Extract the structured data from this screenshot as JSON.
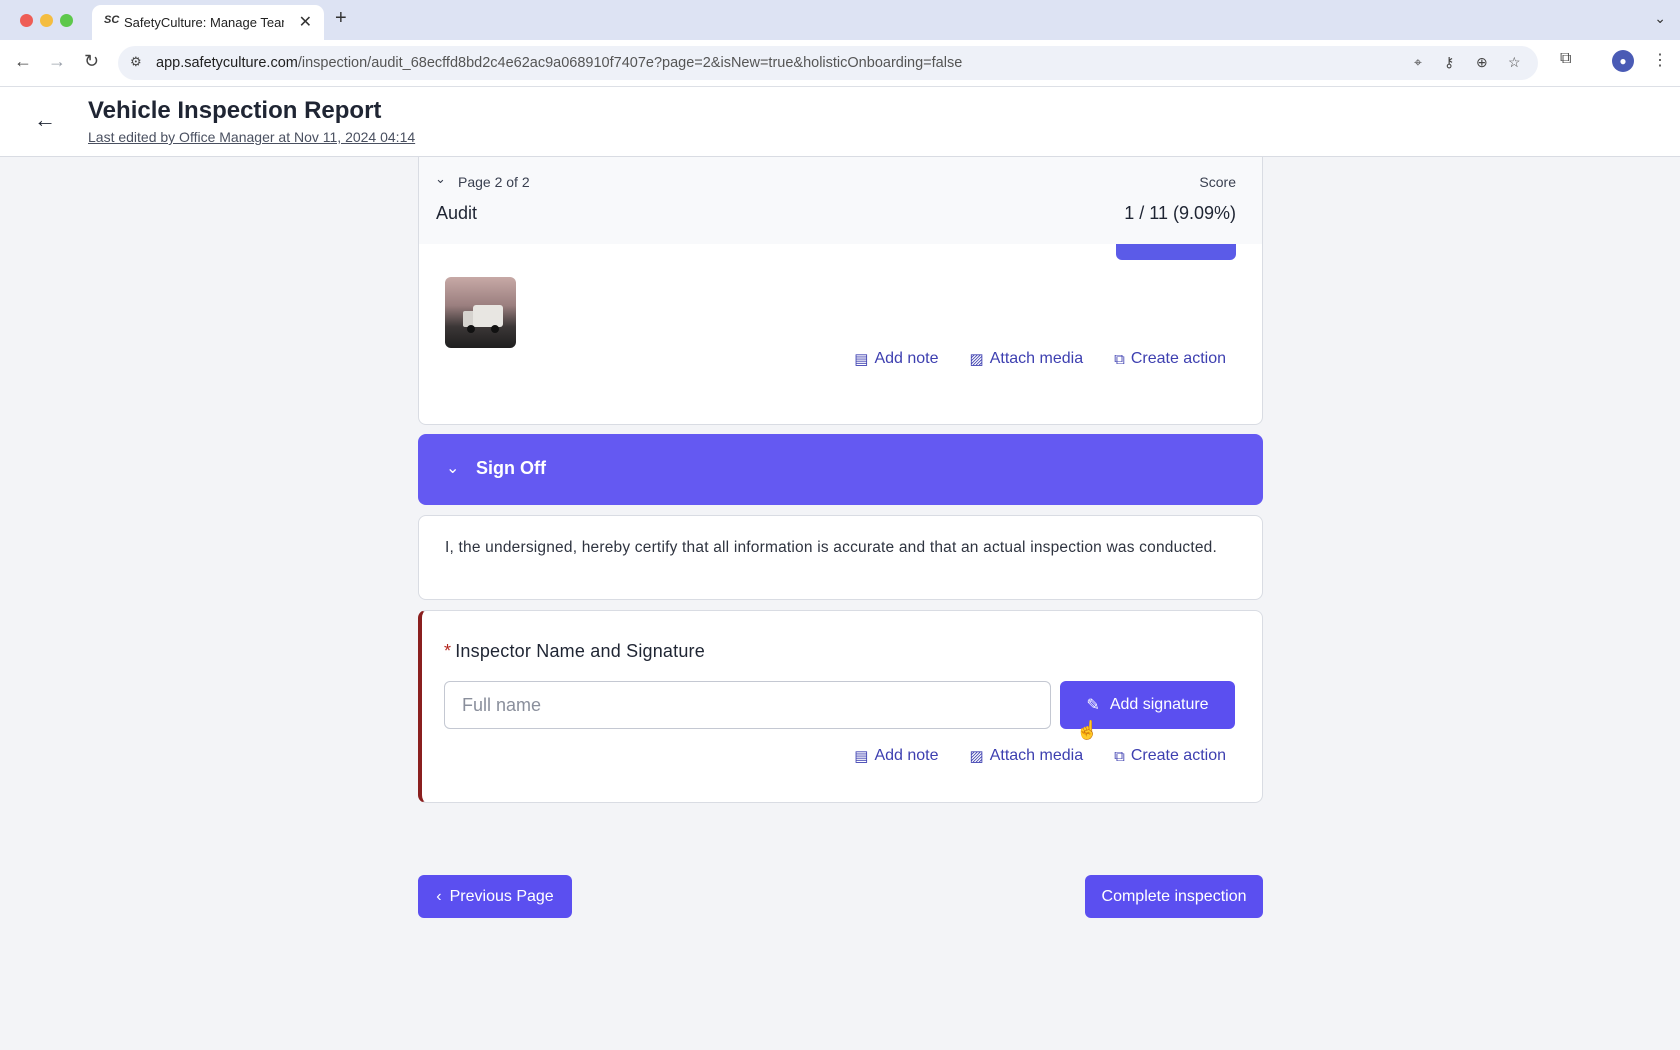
{
  "browser": {
    "tab_favicon": "SC",
    "tab_title": "SafetyCulture: Manage Teams",
    "tab_close": "✕",
    "new_tab": "+",
    "tab_menu": "⌄",
    "url_host": "app.safetyculture.com",
    "url_path": "/inspection/audit_68ecffd8bd2c4e62ac9a068910f7407e?page=2&isNew=true&holisticOnboarding=false",
    "back_icon": "←",
    "forward_icon": "→",
    "reload_icon": "↻"
  },
  "header": {
    "back_icon": "←",
    "title": "Vehicle Inspection Report",
    "last_edited": "Last edited by Office Manager at Nov 11, 2024 04:14"
  },
  "page_section": {
    "indicator": "Page 2 of 2",
    "name": "Audit",
    "score_label": "Score",
    "score_value": "1 / 11 (9.09%)"
  },
  "actions": {
    "add_note": "Add note",
    "attach_media": "Attach media",
    "create_action": "Create action"
  },
  "signoff": {
    "title": "Sign Off",
    "certify_text": "I, the undersigned, hereby certify that all information is accurate and that an actual inspection was conducted.",
    "required_marker": "*",
    "question": "Inspector Name and Signature",
    "name_placeholder": "Full name",
    "add_signature_label": "Add signature"
  },
  "footer": {
    "previous_label": "Previous Page",
    "complete_label": "Complete inspection"
  },
  "colors": {
    "accent": "#5b4ff0",
    "signoff_bar": "#6459f2",
    "link": "#3d3fb0",
    "required_border": "#8a1f1f"
  }
}
